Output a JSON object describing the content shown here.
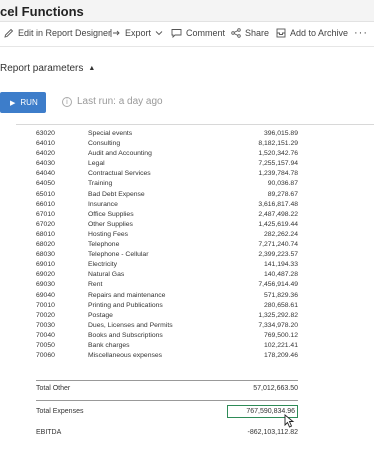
{
  "window": {
    "title": "cel Functions"
  },
  "toolbar": {
    "edit_label": "Edit in Report Designer",
    "export_label": "Export",
    "comment_label": "Comment",
    "share_label": "Share",
    "archive_label": "Add to Archive",
    "more_label": "···"
  },
  "params": {
    "label": "Report parameters",
    "caret": "▲"
  },
  "run": {
    "label": "RUN",
    "icon": "play-icon",
    "color": "#3d7dca"
  },
  "lastrun": {
    "text": "Last run: a day ago"
  },
  "report": {
    "rows": [
      {
        "code": "63020",
        "name": "Special events",
        "value": "396,015.89"
      },
      {
        "code": "64010",
        "name": "Consulting",
        "value": "8,182,151.29"
      },
      {
        "code": "64020",
        "name": "Audit and Accounting",
        "value": "1,520,342.76"
      },
      {
        "code": "64030",
        "name": "Legal",
        "value": "7,255,157.94"
      },
      {
        "code": "64040",
        "name": "Contractual Services",
        "value": "1,239,784.78"
      },
      {
        "code": "64050",
        "name": "Training",
        "value": "90,036.87"
      },
      {
        "code": "65010",
        "name": "Bad Debt Expense",
        "value": "89,278.67"
      },
      {
        "code": "66010",
        "name": "Insurance",
        "value": "3,616,817.48"
      },
      {
        "code": "67010",
        "name": "Office Supplies",
        "value": "2,487,498.22"
      },
      {
        "code": "67020",
        "name": "Other Supplies",
        "value": "1,425,619.44"
      },
      {
        "code": "68010",
        "name": "Hosting Fees",
        "value": "282,262.24"
      },
      {
        "code": "68020",
        "name": "Telephone",
        "value": "7,271,240.74"
      },
      {
        "code": "68030",
        "name": "Telephone - Cellular",
        "value": "2,399,223.57"
      },
      {
        "code": "69010",
        "name": "Electricity",
        "value": "141,194.33"
      },
      {
        "code": "69020",
        "name": "Natural Gas",
        "value": "140,487.28"
      },
      {
        "code": "69030",
        "name": "Rent",
        "value": "7,456,914.49"
      },
      {
        "code": "69040",
        "name": "Repairs and maintenance",
        "value": "571,829.36"
      },
      {
        "code": "70010",
        "name": "Printing and Publications",
        "value": "280,658.61"
      },
      {
        "code": "70020",
        "name": "Postage",
        "value": "1,325,292.82"
      },
      {
        "code": "70030",
        "name": "Dues, Licenses and Permits",
        "value": "7,334,978.20"
      },
      {
        "code": "70040",
        "name": "Books and Subscriptions",
        "value": "769,500.12"
      },
      {
        "code": "70050",
        "name": "Bank charges",
        "value": "102,221.41"
      },
      {
        "code": "70060",
        "name": "Miscellaneous expenses",
        "value": "178,209.46"
      }
    ],
    "total_other": {
      "label": "Total Other",
      "value": "57,012,663.50"
    },
    "total_expenses": {
      "label": "Total Expenses",
      "value": "767,590,834.96"
    },
    "ebitda": {
      "label": "EBITDA",
      "value": "-862,103,112.82"
    }
  }
}
